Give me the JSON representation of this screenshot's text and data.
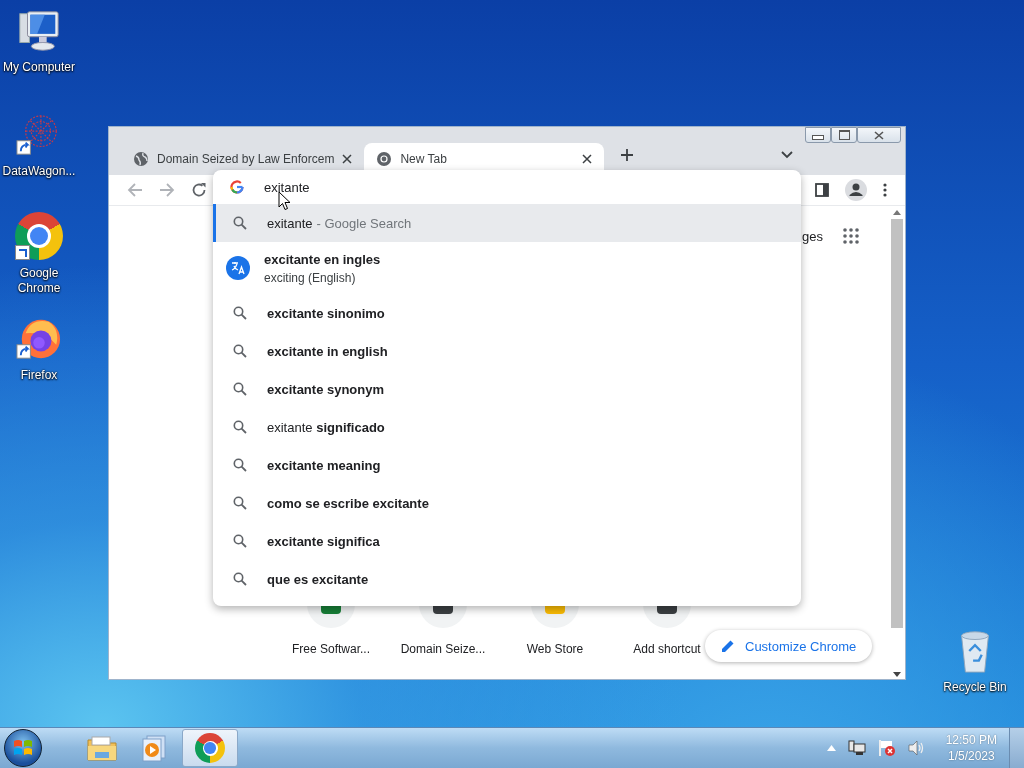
{
  "desktop_icons": [
    {
      "kind": "computer",
      "label": "My Computer"
    },
    {
      "kind": "datawagon",
      "label": "DataWagon..."
    },
    {
      "kind": "chrome",
      "label": "Google Chrome"
    },
    {
      "kind": "firefox",
      "label": "Firefox"
    },
    {
      "kind": "recycle_bin",
      "label": "Recycle Bin"
    }
  ],
  "browser": {
    "tabs": [
      {
        "kind": "globe",
        "title": "Domain Seized by Law Enforcem",
        "selected": false
      },
      {
        "kind": "chrome",
        "title": "New Tab",
        "selected": true
      }
    ],
    "omnibox": {
      "value": "exitante"
    },
    "suggestions": [
      {
        "kind": "search",
        "text": "exitante",
        "description": "- Google Search",
        "bold": false,
        "selected": true
      },
      {
        "kind": "translate",
        "text": "excitante en ingles",
        "description": "exciting (English)",
        "bold": true,
        "selected": false
      },
      {
        "kind": "search",
        "text": "excitante sinonimo",
        "bold": true,
        "selected": false
      },
      {
        "kind": "search",
        "text": "excitante in english",
        "bold": true,
        "selected": false
      },
      {
        "kind": "search",
        "text": "excitante synonym",
        "bold": true,
        "selected": false
      },
      {
        "kind": "search",
        "text": "exitante **significado**",
        "bold": false,
        "selected": false
      },
      {
        "kind": "search",
        "text": "excitante meaning",
        "bold": true,
        "selected": false
      },
      {
        "kind": "search",
        "text": "como se escribe excitante",
        "bold": true,
        "selected": false
      },
      {
        "kind": "search",
        "text": "excitante significa",
        "bold": true,
        "selected": false
      },
      {
        "kind": "search",
        "text": "que es excitante",
        "bold": true,
        "selected": false
      }
    ],
    "page": {
      "header_link": "ges",
      "shortcuts": [
        {
          "label": "Free Softwar..."
        },
        {
          "label": "Domain Seize..."
        },
        {
          "label": "Web Store"
        },
        {
          "label": "Add shortcut"
        }
      ],
      "customize_button": "Customize Chrome"
    }
  },
  "taskbar": {
    "items": [
      {
        "kind": "explorer",
        "selected": false
      },
      {
        "kind": "media_player",
        "selected": false
      },
      {
        "kind": "chrome",
        "selected": true
      }
    ],
    "time": "12:50 PM",
    "date": "1/5/2023"
  }
}
